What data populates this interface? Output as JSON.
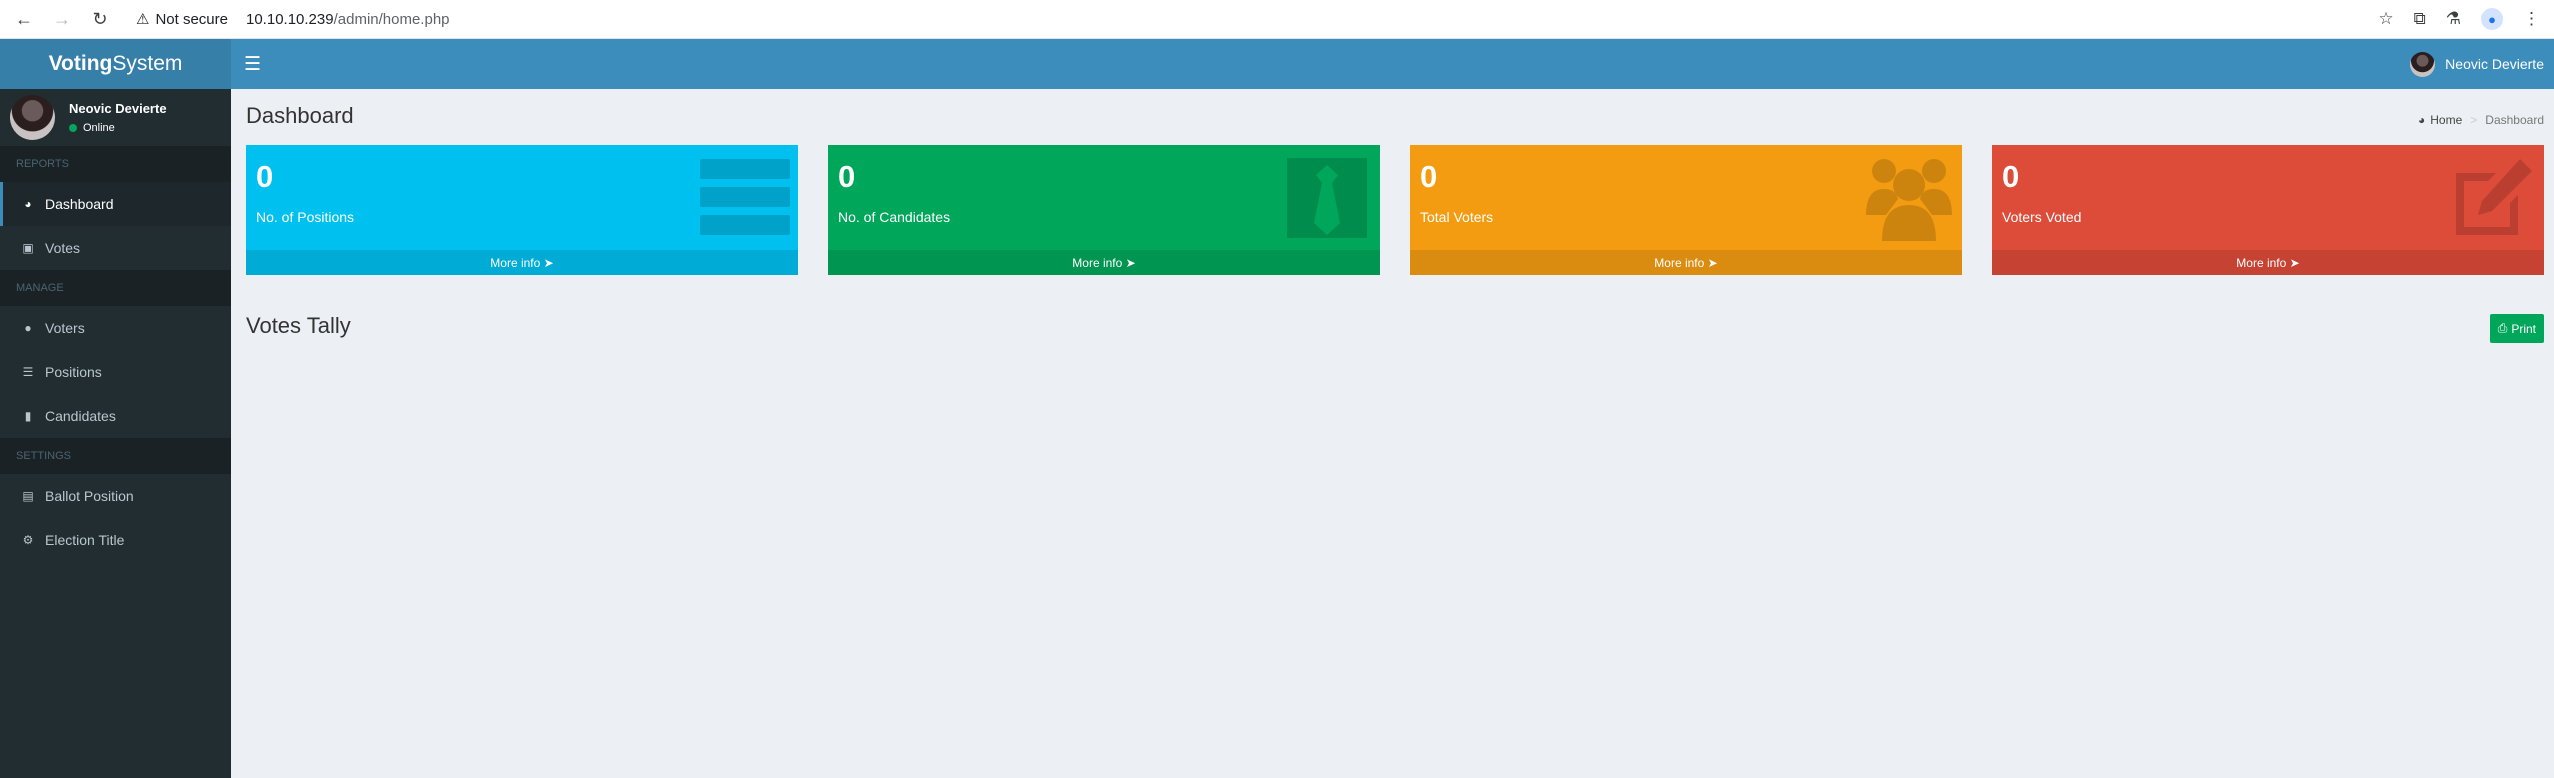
{
  "browser": {
    "security_label": "Not secure",
    "url_host": "10.10.10.239",
    "url_path": "/admin/home.php"
  },
  "logo": {
    "bold": "Voting",
    "rest": "System"
  },
  "user": {
    "name": "Neovic Devierte",
    "status": "Online"
  },
  "sidebar": {
    "sections": [
      {
        "header": "REPORTS",
        "items": [
          {
            "label": "Dashboard",
            "icon": "dashboard-icon"
          },
          {
            "label": "Votes",
            "icon": "lock-icon"
          }
        ]
      },
      {
        "header": "MANAGE",
        "items": [
          {
            "label": "Voters",
            "icon": "users-icon"
          },
          {
            "label": "Positions",
            "icon": "tasks-icon"
          },
          {
            "label": "Candidates",
            "icon": "black-tie-icon"
          }
        ]
      },
      {
        "header": "SETTINGS",
        "items": [
          {
            "label": "Ballot Position",
            "icon": "file-text-icon"
          },
          {
            "label": "Election Title",
            "icon": "cog-icon"
          }
        ]
      }
    ]
  },
  "header": {
    "page_title": "Dashboard"
  },
  "breadcrumb": {
    "home": "Home",
    "current": "Dashboard"
  },
  "stats": [
    {
      "value": "0",
      "label": "No. of Positions",
      "more": "More info",
      "color": "#00c0ef",
      "icon": "tasks-icon"
    },
    {
      "value": "0",
      "label": "No. of Candidates",
      "more": "More info",
      "color": "#00a65a",
      "icon": "black-tie-icon"
    },
    {
      "value": "0",
      "label": "Total Voters",
      "more": "More info",
      "color": "#f39c12",
      "icon": "users-icon"
    },
    {
      "value": "0",
      "label": "Voters Voted",
      "more": "More info",
      "color": "#dd4b39",
      "icon": "edit-icon"
    }
  ],
  "tally": {
    "title": "Votes Tally",
    "print_label": "Print"
  }
}
